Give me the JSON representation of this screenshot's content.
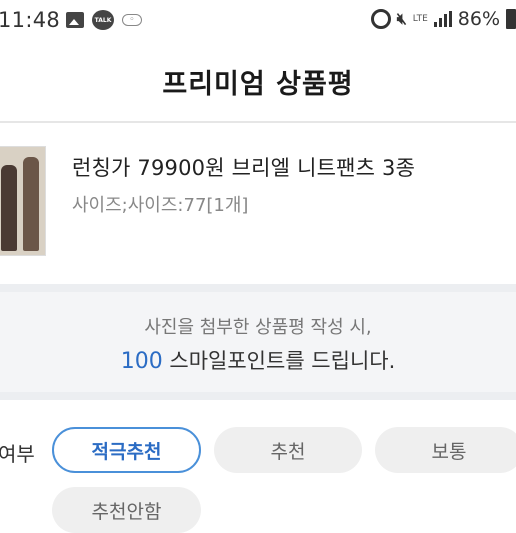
{
  "status_bar": {
    "time": "11:48",
    "talk_icon_text": "TALK",
    "lte": "LTE",
    "battery": "86%"
  },
  "header": {
    "title": "프리미엄 상품평"
  },
  "product": {
    "name": "런칭가 79900원 브리엘 니트팬츠 3종",
    "option": "사이즈;사이즈:77[1개]"
  },
  "banner": {
    "line1": "사진을 첨부한 상품평 작성 시,",
    "points": "100",
    "line2_rest": " 스마일포인트를 드립니다."
  },
  "recommend": {
    "label": "여부",
    "options": [
      {
        "label": "적극추천",
        "selected": true
      },
      {
        "label": "추천",
        "selected": false
      },
      {
        "label": "보통",
        "selected": false
      },
      {
        "label": "추천안함",
        "selected": false
      }
    ]
  },
  "colors": {
    "accent": "#2b6cc4",
    "pill_border": "#4a90d9",
    "pill_bg": "#efefef",
    "banner_bg": "#f4f5f7"
  }
}
